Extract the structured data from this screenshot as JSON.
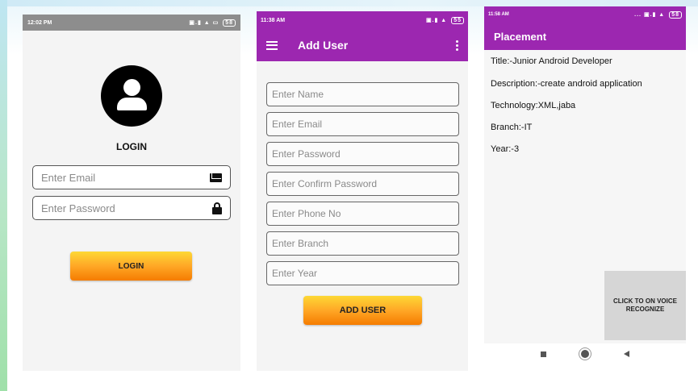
{
  "screen1": {
    "status": {
      "time": "12:02 PM",
      "icons": "▣.▮ ▲ ▭",
      "battery": "58"
    },
    "title": "LOGIN",
    "email_placeholder": "Enter Email",
    "password_placeholder": "Enter Password",
    "login_button": "LOGIN",
    "icons": {
      "avatar": "person-icon",
      "email": "mail-icon",
      "password": "lock-icon"
    }
  },
  "screen2": {
    "status": {
      "time": "11:38 AM",
      "icons": "▣.▮ ▲",
      "battery": "55"
    },
    "appbar_title": "Add User",
    "fields": [
      {
        "name": "name-field",
        "placeholder": "Enter Name"
      },
      {
        "name": "email-field",
        "placeholder": "Enter Email"
      },
      {
        "name": "password-field",
        "placeholder": "Enter Password"
      },
      {
        "name": "confirm-password-field",
        "placeholder": "Enter Confirm Password"
      },
      {
        "name": "phone-field",
        "placeholder": "Enter Phone No"
      },
      {
        "name": "branch-field",
        "placeholder": "Enter Branch"
      },
      {
        "name": "year-field",
        "placeholder": "Enter Year"
      }
    ],
    "add_button": "ADD USER"
  },
  "screen3": {
    "status": {
      "time": "11:58 AM",
      "icons": "... ▣.▮ ▲",
      "battery": "58"
    },
    "appbar_title": "Placement",
    "lines": [
      "Title:-Junior Android Developer",
      "Description:-create android application",
      "Technology:XML,jaba",
      "Branch:-IT",
      "Year:-3"
    ],
    "voice_button": "CLICK TO ON VOICE RECOGNIZE"
  },
  "colors": {
    "primary": "#9c27b0",
    "button_top": "#fdd835",
    "button_bottom": "#f57c00"
  }
}
